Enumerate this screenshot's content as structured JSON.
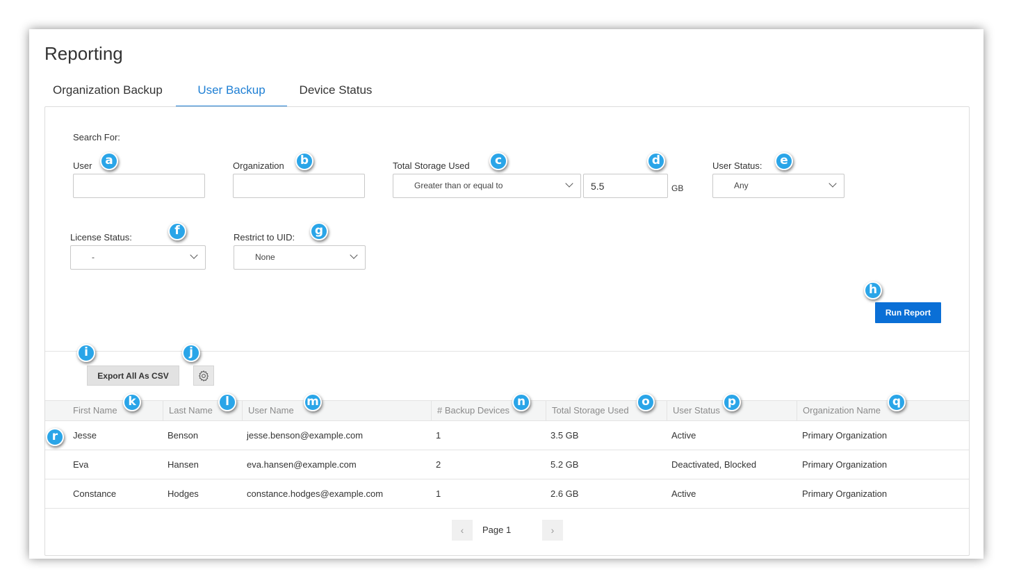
{
  "page": {
    "title": "Reporting"
  },
  "tabs": [
    {
      "label": "Organization Backup",
      "active": false
    },
    {
      "label": "User Backup",
      "active": true
    },
    {
      "label": "Device Status",
      "active": false
    }
  ],
  "search": {
    "heading": "Search For:",
    "user_label": "User",
    "user_value": "",
    "org_label": "Organization",
    "org_value": "",
    "storage_label": "Total Storage Used",
    "storage_operator": "Greater than or equal to",
    "storage_value": "5.5",
    "storage_unit": "GB",
    "user_status_label": "User Status:",
    "user_status_value": "Any",
    "license_label": "License Status:",
    "license_value": "-",
    "uid_label": "Restrict to UID:",
    "uid_value": "None"
  },
  "actions": {
    "run_report": "Run Report",
    "export_csv": "Export All As CSV",
    "settings_icon": "gear-icon"
  },
  "table": {
    "columns": [
      "First Name",
      "Last Name",
      "User Name",
      "# Backup Devices",
      "Total Storage Used",
      "User Status",
      "Organization Name"
    ],
    "rows": [
      [
        "Jesse",
        "Benson",
        "jesse.benson@example.com",
        "1",
        "3.5 GB",
        "Active",
        "Primary Organization"
      ],
      [
        "Eva",
        "Hansen",
        "eva.hansen@example.com",
        "2",
        "5.2 GB",
        "Deactivated, Blocked",
        "Primary Organization"
      ],
      [
        "Constance",
        "Hodges",
        "constance.hodges@example.com",
        "1",
        "2.6 GB",
        "Active",
        "Primary Organization"
      ]
    ]
  },
  "pagination": {
    "label": "Page 1",
    "prev": "‹",
    "next": "›"
  },
  "annotations": [
    "a",
    "b",
    "c",
    "d",
    "e",
    "f",
    "g",
    "h",
    "i",
    "j",
    "k",
    "l",
    "m",
    "n",
    "o",
    "p",
    "q",
    "r"
  ],
  "colors": {
    "accent": "#1e7fd4",
    "button": "#0a6fd6",
    "badge": "#2aa5e8"
  }
}
